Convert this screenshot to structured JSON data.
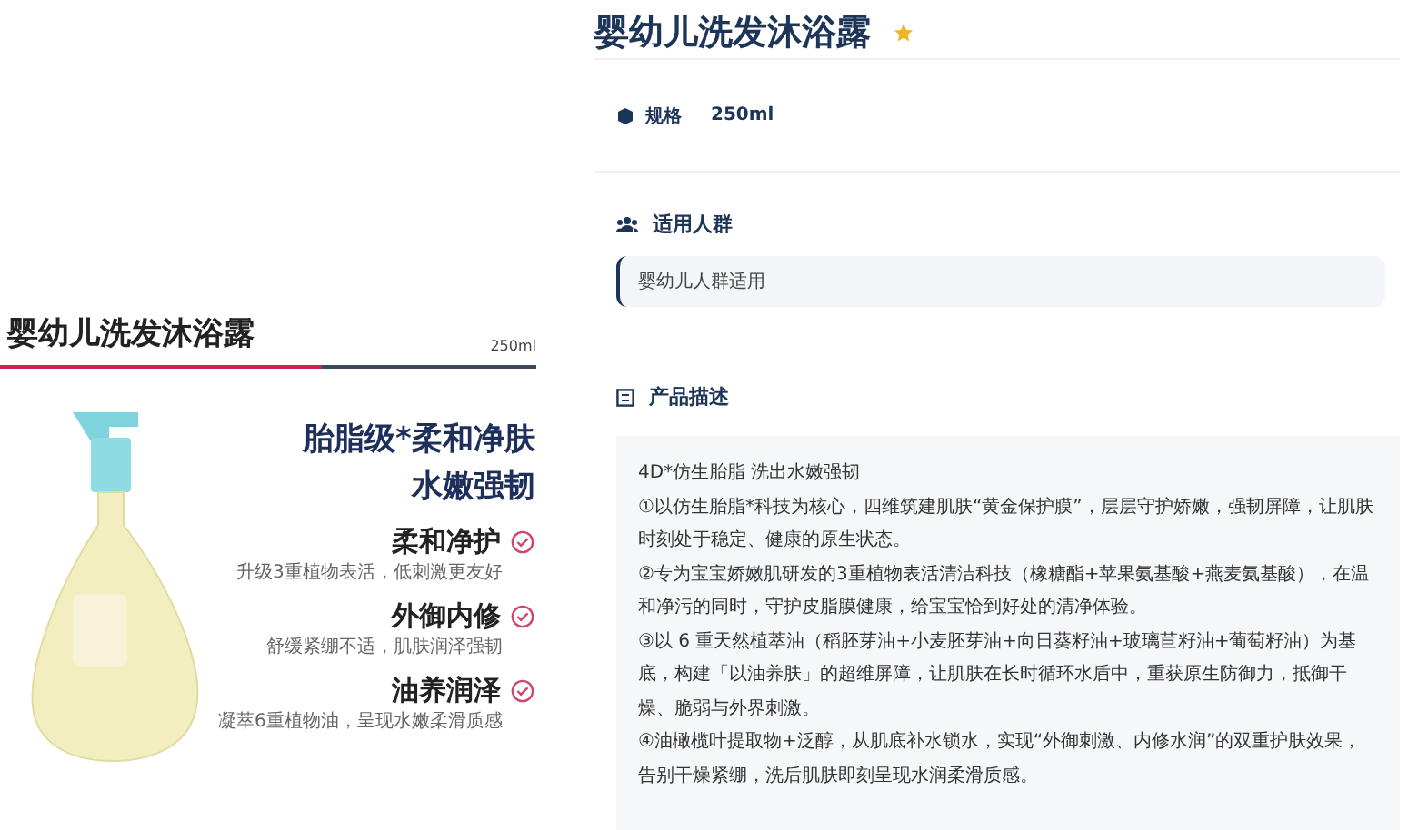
{
  "promo": {
    "title": "婴幼儿洗发沐浴露",
    "volume": "250ml",
    "headline": [
      "胎脂级*柔和净肤",
      "水嫩强韧"
    ],
    "features": [
      {
        "title": "柔和净护",
        "desc": "升级3重植物表活，低刺激更友好"
      },
      {
        "title": "外御内修",
        "desc": "舒缓紧绷不适，肌肤润泽强韧"
      },
      {
        "title": "油养润泽",
        "desc": "凝萃6重植物油，呈现水嫩柔滑质感"
      }
    ]
  },
  "product": {
    "title": "婴幼儿洗发沐浴露",
    "favorite": true,
    "spec": {
      "label": "规格",
      "value": "250ml"
    },
    "audience": {
      "heading": "适用人群",
      "text": "婴幼儿人群适用"
    },
    "description": {
      "heading": "产品描述",
      "paragraphs": [
        "4D*仿生胎脂  洗出水嫩强韧",
        "①以仿生胎脂*科技为核心，四维筑建肌肤“黄金保护膜”，层层守护娇嫩，强韧屏障，让肌肤时刻处于稳定、健康的原生状态。",
        "②专为宝宝娇嫩肌研发的3重植物表活清洁科技（橡糖酯+苹果氨基酸+燕麦氨基酸），在温和净污的同时，守护皮脂膜健康，给宝宝恰到好处的清净体验。",
        "③以 6 重天然植萃油（稻胚芽油+小麦胚芽油+向日葵籽油+玻璃苣籽油+葡萄籽油）为基底，构建「以油养肤」的超维屏障，让肌肤在长时循环水盾中，重获原生防御力，抵御干燥、脆弱与外界刺激。",
        "④油橄榄叶提取物+泛醇，从肌底补水锁水，实现“外御刺激、内修水润”的双重护肤效果，告别干燥紧绷，洗后肌肤即刻呈现水润柔滑质感。"
      ]
    }
  }
}
